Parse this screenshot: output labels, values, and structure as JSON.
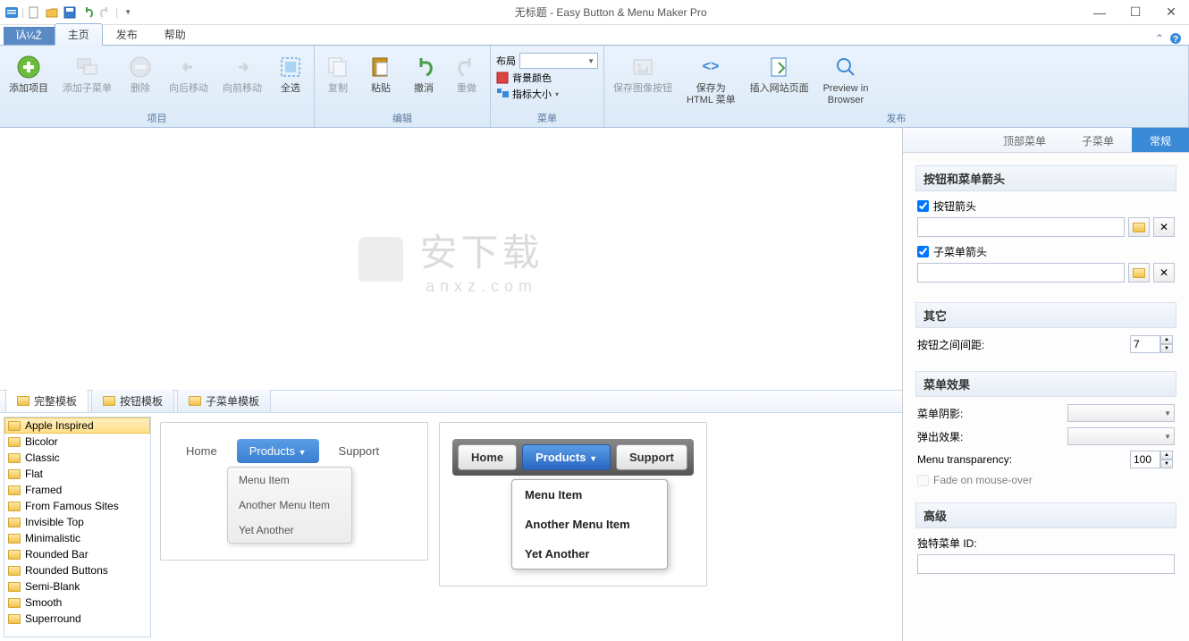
{
  "title": "无标题 - Easy Button & Menu Maker Pro",
  "fileTab": "ÏÂ¼Ž",
  "tabs": {
    "home": "主页",
    "publish": "发布",
    "help": "帮助"
  },
  "ribbon": {
    "groups": {
      "project": {
        "label": "项目",
        "addItem": "添加项目",
        "addSubmenu": "添加子菜单",
        "delete": "删除",
        "moveBack": "向后移动",
        "moveFwd": "向前移动",
        "selectAll": "全选"
      },
      "edit": {
        "label": "编辑",
        "copy": "复制",
        "paste": "粘贴",
        "undo": "撤消",
        "redo": "重做"
      },
      "menu": {
        "label": "菜单",
        "layout": "布局",
        "bgcolor": "背景颜色",
        "iconSize": "指标大小"
      },
      "publish": {
        "label": "发布",
        "saveImg": "保存图像按钮",
        "saveHtml": "保存为\nHTML 菜单",
        "insertPage": "插入网站页面",
        "preview": "Preview in\nBrowser"
      }
    }
  },
  "watermark": {
    "top": "安下载",
    "bot": "anxz.com"
  },
  "tplTabs": {
    "full": "完整模板",
    "button": "按钮模板",
    "submenu": "子菜单模板"
  },
  "templates": [
    "Apple Inspired",
    "Bicolor",
    "Classic",
    "Flat",
    "Framed",
    "From Famous Sites",
    "Invisible Top",
    "Minimalistic",
    "Rounded Bar",
    "Rounded Buttons",
    "Semi-Blank",
    "Smooth",
    "Superround"
  ],
  "preview": {
    "menuItems": {
      "home": "Home",
      "products": "Products",
      "support": "Support"
    },
    "subItems": [
      "Menu Item",
      "Another Menu Item",
      "Yet Another"
    ]
  },
  "rightTabs": {
    "top": "顶部菜单",
    "sub": "子菜单",
    "general": "常规"
  },
  "panel": {
    "arrows": {
      "title": "按钮和菜单箭头",
      "btnArrow": "按钮箭头",
      "subArrow": "子菜单箭头"
    },
    "other": {
      "title": "其它",
      "spacing": "按钮之间间距:",
      "spacingVal": "7"
    },
    "effects": {
      "title": "菜单效果",
      "shadow": "菜单阴影:",
      "popup": "弹出效果:",
      "transparency": "Menu transparency:",
      "transVal": "100",
      "fade": "Fade on mouse-over"
    },
    "advanced": {
      "title": "高级",
      "uniqueId": "独特菜单 ID:"
    }
  }
}
